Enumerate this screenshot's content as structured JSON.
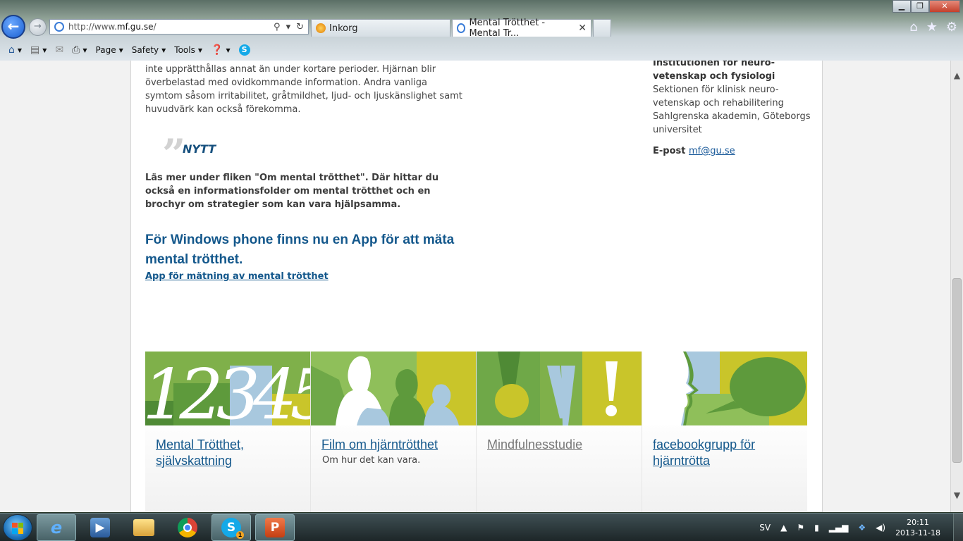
{
  "browser": {
    "address": {
      "url_prefix": "http://www.",
      "url_domain": "mf.gu.se",
      "url_suffix": "/"
    },
    "tabs": [
      {
        "label": "Inkorg",
        "active": false
      },
      {
        "label": "Mental Trötthet - Mental Tr...",
        "active": true
      }
    ],
    "command_bar": {
      "page": "Page",
      "safety": "Safety",
      "tools": "Tools"
    }
  },
  "content": {
    "intro_text": "inte upprätthållas annat än under kortare perioder. Hjärnan blir överbelastad med ovidkommande information. Andra vanliga symtom såsom irritabilitet, gråtmildhet, ljud- och ljuskänslighet samt huvudvärk kan också förekomma.",
    "quote_label": "NYTT",
    "news_text": "Läs mer under fliken \"Om mental trötthet\". Där hittar du också en informationsfolder om mental trötthet och en brochyr om strategier som kan vara hjälpsamma.",
    "windows_heading": "För Windows phone finns nu en App för att mäta mental trötthet.",
    "app_link": "App för mätning av mental trötthet"
  },
  "sidebar": {
    "institution": "Institutionen för neuro-vetenskap och fysiologi",
    "section": "Sektionen för klinisk neuro-vetenskap och rehabilitering Sahlgrenska akademin, Göteborgs universitet",
    "email_label": "E-post",
    "email": "mf@gu.se"
  },
  "tiles": [
    {
      "title": "Mental Trötthet, självskattning",
      "desc": ""
    },
    {
      "title": "Film om hjärntrötthet",
      "desc": "Om hur det kan vara."
    },
    {
      "title": "Mindfulnesstudie",
      "desc": ""
    },
    {
      "title": "facebookgrupp för hjärntrötta",
      "desc": ""
    }
  ],
  "tile_numbers": "12345",
  "taskbar": {
    "language": "SV",
    "time": "20:11",
    "date": "2013-11-18",
    "skype_badge": "1"
  },
  "colors": {
    "link": "#14588c",
    "tile_green": "#7fb04a",
    "tile_yellow": "#c9c52a",
    "tile_light_blue": "#a8c8de"
  }
}
